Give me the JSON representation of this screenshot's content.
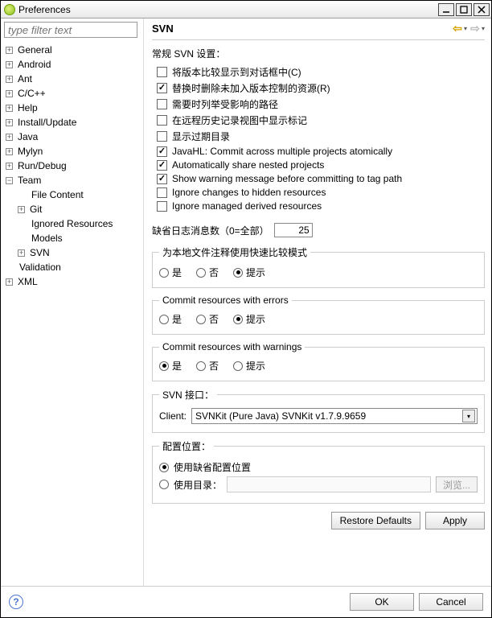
{
  "window": {
    "title": "Preferences"
  },
  "filter": {
    "placeholder": "type filter text"
  },
  "tree": {
    "n0": "General",
    "n1": "Android",
    "n2": "Ant",
    "n3": "C/C++",
    "n4": "Help",
    "n5": "Install/Update",
    "n6": "Java",
    "n7": "Mylyn",
    "n8": "Run/Debug",
    "n9": "Team",
    "n9a": "File Content",
    "n9b": "Git",
    "n9c": "Ignored Resources",
    "n9d": "Models",
    "n9e": "SVN",
    "n10": "Validation",
    "n11": "XML"
  },
  "page": {
    "title": "SVN",
    "general_label": "常规 SVN 设置：",
    "chk": {
      "c1": "将版本比较显示到对话框中(C)",
      "c2": "替换时删除未加入版本控制的资源(R)",
      "c3": "需要时列举受影响的路径",
      "c4": "在远程历史记录视图中显示标记",
      "c5": "显示过期目录",
      "c6": "JavaHL: Commit across multiple projects atomically",
      "c7": "Automatically share nested projects",
      "c8": "Show warning message before committing to tag path",
      "c9": "Ignore changes to hidden resources",
      "c10": "Ignore managed derived resources"
    },
    "log_label": "缺省日志消息数（0=全部）",
    "log_value": "25",
    "grp_quick": "为本地文件注释使用快速比较模式",
    "grp_err": "Commit resources with errors",
    "grp_warn": "Commit resources with warnings",
    "opt_yes": "是",
    "opt_no": "否",
    "opt_prompt": "提示",
    "grp_iface": "SVN 接口：",
    "client_label": "Client:",
    "client_value": "SVNKit (Pure Java) SVNKit v1.7.9.9659",
    "grp_cfgloc": "配置位置：",
    "cfg_default": "使用缺省配置位置",
    "cfg_dir": "使用目录：",
    "browse": "浏览...",
    "restore": "Restore Defaults",
    "apply": "Apply"
  },
  "footer": {
    "ok": "OK",
    "cancel": "Cancel"
  }
}
